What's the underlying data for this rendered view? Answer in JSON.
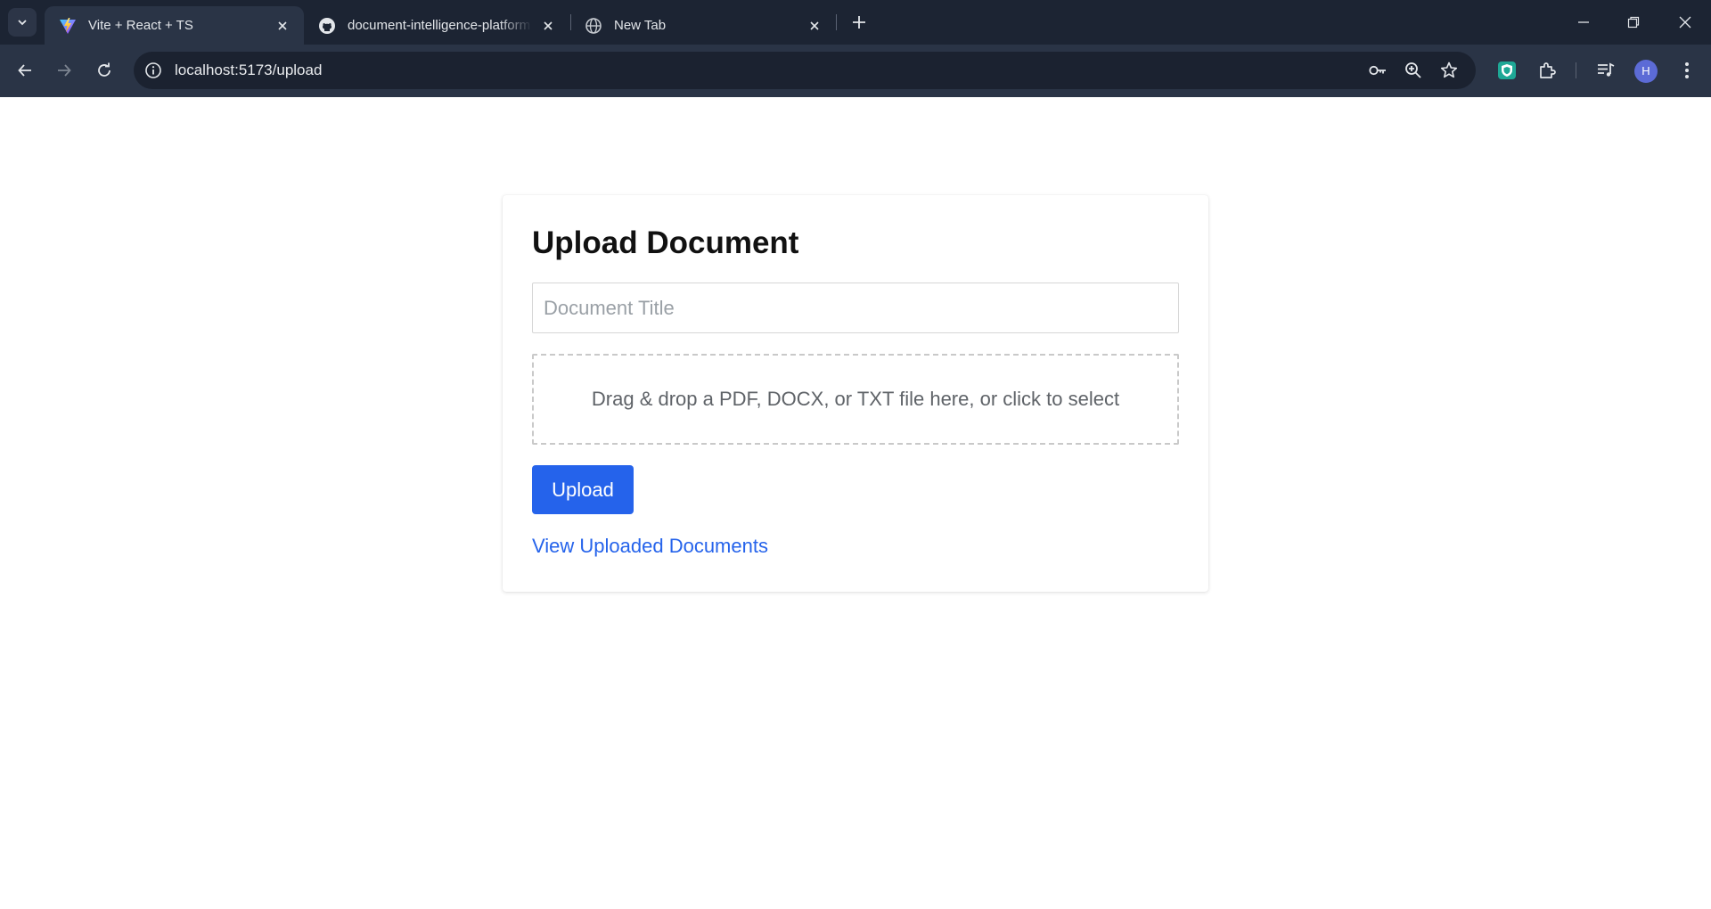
{
  "browser": {
    "tabs": [
      {
        "title": "Vite + React + TS",
        "favicon": "vite-icon",
        "active": true
      },
      {
        "title": "document-intelligence-platform",
        "favicon": "github-icon",
        "active": false
      },
      {
        "title": "New Tab",
        "favicon": "globe-icon",
        "active": false
      }
    ],
    "address_bar": {
      "url": "localhost:5173/upload"
    },
    "profile_initial": "H"
  },
  "upload_page": {
    "heading": "Upload Document",
    "title_input": {
      "placeholder": "Document Title",
      "value": ""
    },
    "dropzone_text": "Drag & drop a PDF, DOCX, or TXT file here, or click to select",
    "upload_button": "Upload",
    "view_docs_link": "View Uploaded Documents"
  },
  "colors": {
    "chrome_bg": "#1c2433",
    "toolbar_bg": "#2a3446",
    "accent_blue": "#2563eb"
  }
}
